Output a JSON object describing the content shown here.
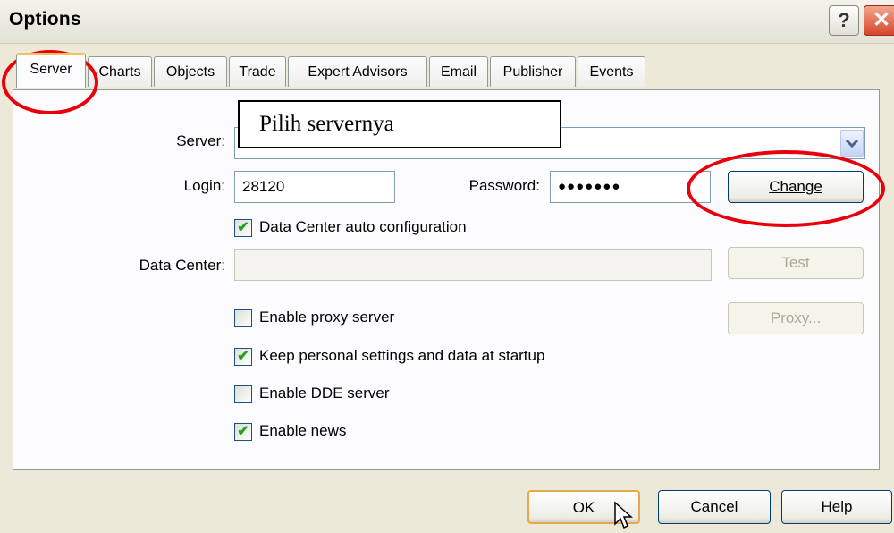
{
  "window": {
    "title": "Options"
  },
  "titlebar": {
    "help_glyph": "?",
    "close_glyph": "✕"
  },
  "tabs": [
    {
      "label": "Server"
    },
    {
      "label": "Charts"
    },
    {
      "label": "Objects"
    },
    {
      "label": "Trade"
    },
    {
      "label": "Expert Advisors"
    },
    {
      "label": "Email"
    },
    {
      "label": "Publisher"
    },
    {
      "label": "Events"
    }
  ],
  "annotation": {
    "text": "Pilih servernya"
  },
  "server": {
    "label": "Server:",
    "value": ""
  },
  "login": {
    "label": "Login:",
    "value": "28120"
  },
  "password": {
    "label": "Password:",
    "value": "●●●●●●●"
  },
  "buttons": {
    "change": "Change",
    "test": "Test",
    "proxy": "Proxy...",
    "ok": "OK",
    "cancel": "Cancel",
    "help": "Help"
  },
  "data_center": {
    "label": "Data Center:",
    "value": ""
  },
  "checkboxes": [
    {
      "label": "Data Center auto configuration",
      "checked": true
    },
    {
      "label": "Enable proxy server",
      "checked": false
    },
    {
      "label": "Keep personal settings and data at startup",
      "checked": true
    },
    {
      "label": "Enable DDE server",
      "checked": false
    },
    {
      "label": "Enable news",
      "checked": true
    }
  ],
  "icons": {
    "dropdown": "chevron-down-icon",
    "cursor": "mouse-pointer-icon"
  },
  "colors": {
    "annotation_red": "#e8000b",
    "active_tab_accent": "#f1c15b",
    "check_green": "#21a121"
  }
}
